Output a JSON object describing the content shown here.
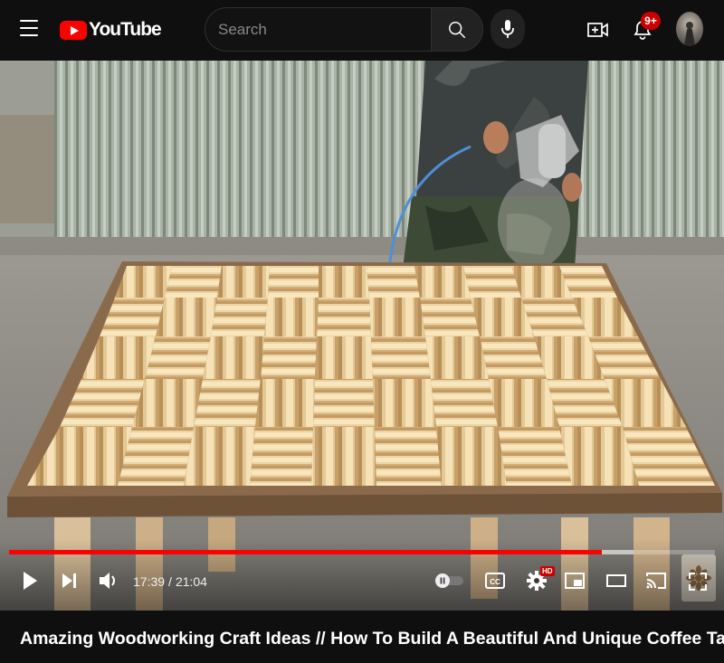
{
  "header": {
    "logo_text": "YouTube",
    "search_placeholder": "Search",
    "notification_count": "9+",
    "icons": {
      "menu": "hamburger-icon",
      "search": "search-icon",
      "mic": "microphone-icon",
      "create": "create-video-icon",
      "notifications": "bell-icon"
    }
  },
  "player": {
    "current_time": "17:39",
    "separator": "/",
    "duration": "21:04",
    "progress_played": 0.84,
    "progress_loaded": 0.885,
    "hd_badge": "HD",
    "cc_label": "CC",
    "accent_color": "#ff0000"
  },
  "video": {
    "title": "Amazing Woodworking Craft Ideas // How To Build A Beautiful And Unique Coffee Table // DIY"
  }
}
